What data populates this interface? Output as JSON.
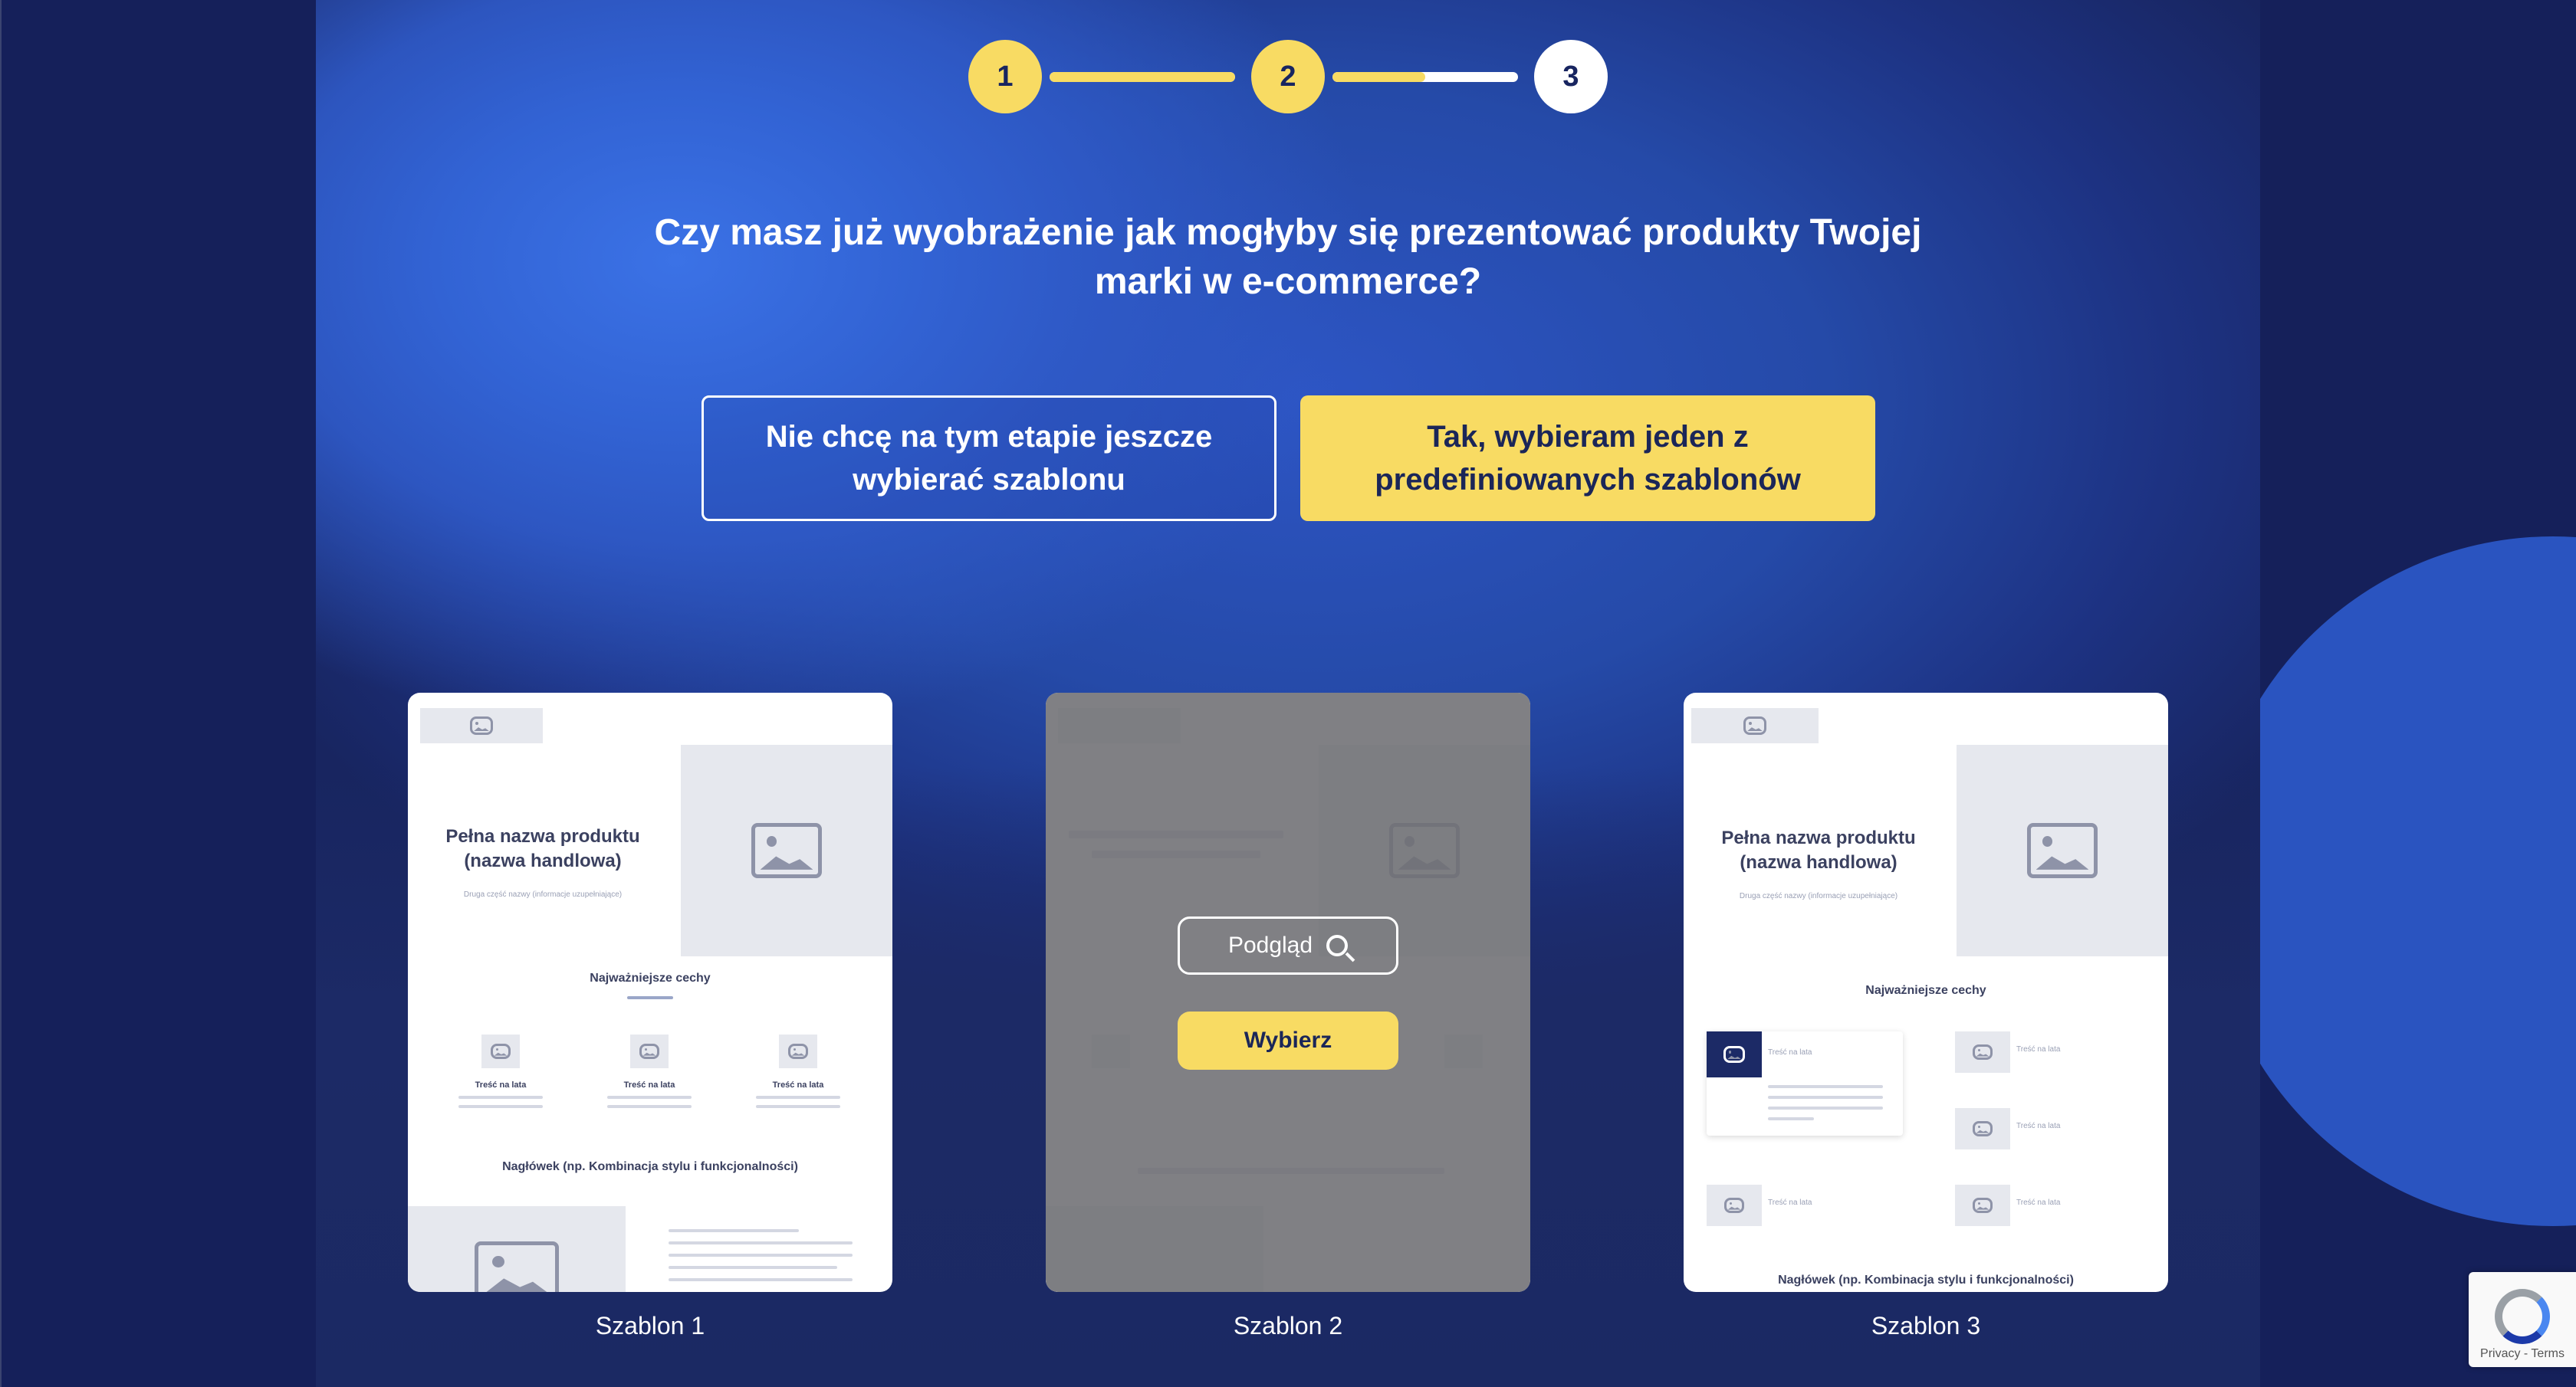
{
  "stepper": {
    "steps": [
      {
        "number": "1",
        "state": "done"
      },
      {
        "number": "2",
        "state": "done"
      },
      {
        "number": "3",
        "state": "current"
      }
    ],
    "progress": [
      1.0,
      0.5
    ]
  },
  "question": "Czy masz już wyobrażenie jak mogłyby się prezentować produkty Twojej marki w e-commerce?",
  "choices": {
    "no_template": "Nie chcę na tym etapie jeszcze wybierać szablonu",
    "predefined": "Tak, wybieram jeden z predefiniowanych szablonów"
  },
  "templates": [
    {
      "label": "Szablon 1",
      "product_name": "Pełna nazwa produktu (nazwa handlowa)",
      "subtitle": "Druga część nazwy (informacje uzupełniające)",
      "features_heading": "Najważniejsze cechy",
      "feature_title": "Treść na lata",
      "section_heading": "Nagłówek (np. Kombinacja stylu i funkcjonalności)"
    },
    {
      "label": "Szablon 2",
      "preview_label": "Podgląd",
      "select_label": "Wybierz"
    },
    {
      "label": "Szablon 3",
      "product_name": "Pełna nazwa produktu (nazwa handlowa)",
      "subtitle": "Druga część nazwy (informacje uzupełniające)",
      "features_heading": "Najważniejsze cechy",
      "feature_title": "Treść na lata",
      "section_heading": "Nagłówek (np. Kombinacja stylu i funkcjonalności)"
    }
  ],
  "recaptcha": {
    "links": "Privacy - Terms"
  },
  "colors": {
    "accent": "#f8db63",
    "background": "#182560",
    "primary": "#2d55c4"
  }
}
